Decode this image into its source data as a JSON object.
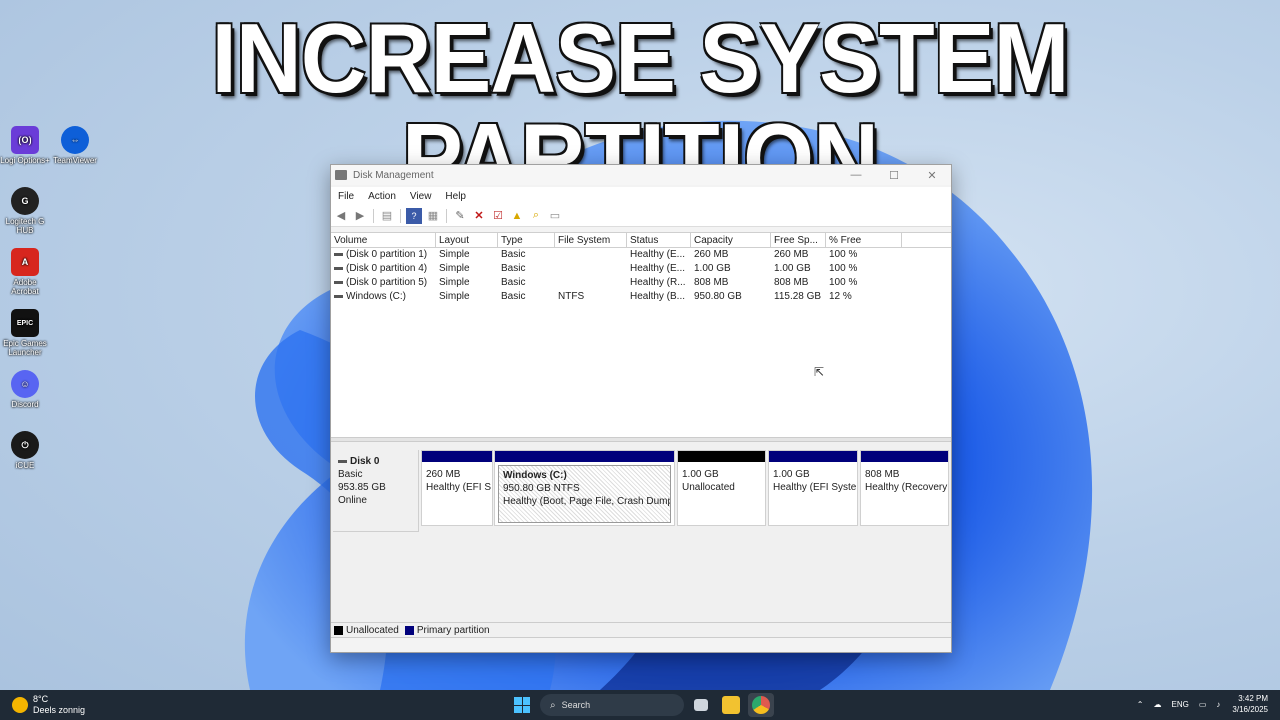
{
  "headline": "INCREASE SYSTEM PARTITION",
  "desktop_icons": [
    {
      "label": "Logi Options+",
      "color": "#6a3cd8",
      "glyph": "⟮O⟯"
    },
    {
      "label": "TeamViewer",
      "color": "#0e5fd8",
      "glyph": "⇔"
    },
    {
      "label": "Logitech G HUB",
      "color": "#222222",
      "glyph": "G"
    },
    {
      "label": "Adobe Acrobat",
      "color": "#d7261e",
      "glyph": "A"
    },
    {
      "label": "Epic Games Launcher",
      "color": "#111111",
      "glyph": "EPIC"
    },
    {
      "label": "Discord",
      "color": "#5865f2",
      "glyph": "☺"
    },
    {
      "label": "iCUE",
      "color": "#1a1a1a",
      "glyph": "⏻"
    }
  ],
  "window": {
    "title": "Disk Management",
    "menu": [
      "File",
      "Action",
      "View",
      "Help"
    ],
    "columns": [
      "Volume",
      "Layout",
      "Type",
      "File System",
      "Status",
      "Capacity",
      "Free Sp...",
      "% Free"
    ],
    "volumes": [
      {
        "volume": "(Disk 0 partition 1)",
        "layout": "Simple",
        "type": "Basic",
        "fs": "",
        "status": "Healthy (E...",
        "capacity": "260 MB",
        "free": "260 MB",
        "pct": "100 %"
      },
      {
        "volume": "(Disk 0 partition 4)",
        "layout": "Simple",
        "type": "Basic",
        "fs": "",
        "status": "Healthy (E...",
        "capacity": "1.00 GB",
        "free": "1.00 GB",
        "pct": "100 %"
      },
      {
        "volume": "(Disk 0 partition 5)",
        "layout": "Simple",
        "type": "Basic",
        "fs": "",
        "status": "Healthy (R...",
        "capacity": "808 MB",
        "free": "808 MB",
        "pct": "100 %"
      },
      {
        "volume": "Windows (C:)",
        "layout": "Simple",
        "type": "Basic",
        "fs": "NTFS",
        "status": "Healthy (B...",
        "capacity": "950.80 GB",
        "free": "115.28 GB",
        "pct": "12 %"
      }
    ],
    "disk": {
      "name": "Disk 0",
      "kind": "Basic",
      "size": "953.85 GB",
      "state": "Online"
    },
    "partitions": [
      {
        "title": "",
        "line1": "260 MB",
        "line2": "Healthy (EFI S",
        "bar": "#00007b"
      },
      {
        "title": "Windows  (C:)",
        "line1": "950.80 GB NTFS",
        "line2": "Healthy (Boot, Page File, Crash Dump,",
        "bar": "#00007b"
      },
      {
        "title": "",
        "line1": "1.00 GB",
        "line2": "Unallocated",
        "bar": "#000000"
      },
      {
        "title": "",
        "line1": "1.00 GB",
        "line2": "Healthy (EFI Syste",
        "bar": "#00007b"
      },
      {
        "title": "",
        "line1": "808 MB",
        "line2": "Healthy (Recovery",
        "bar": "#00007b"
      }
    ],
    "legend": [
      {
        "label": "Unallocated",
        "color": "#000000"
      },
      {
        "label": "Primary partition",
        "color": "#00007b"
      }
    ]
  },
  "taskbar": {
    "weather_temp": "8°C",
    "weather_desc": "Deels zonnig",
    "search_placeholder": "Search",
    "language": "ENG",
    "time": "3:42 PM",
    "date": "3/16/2025"
  }
}
